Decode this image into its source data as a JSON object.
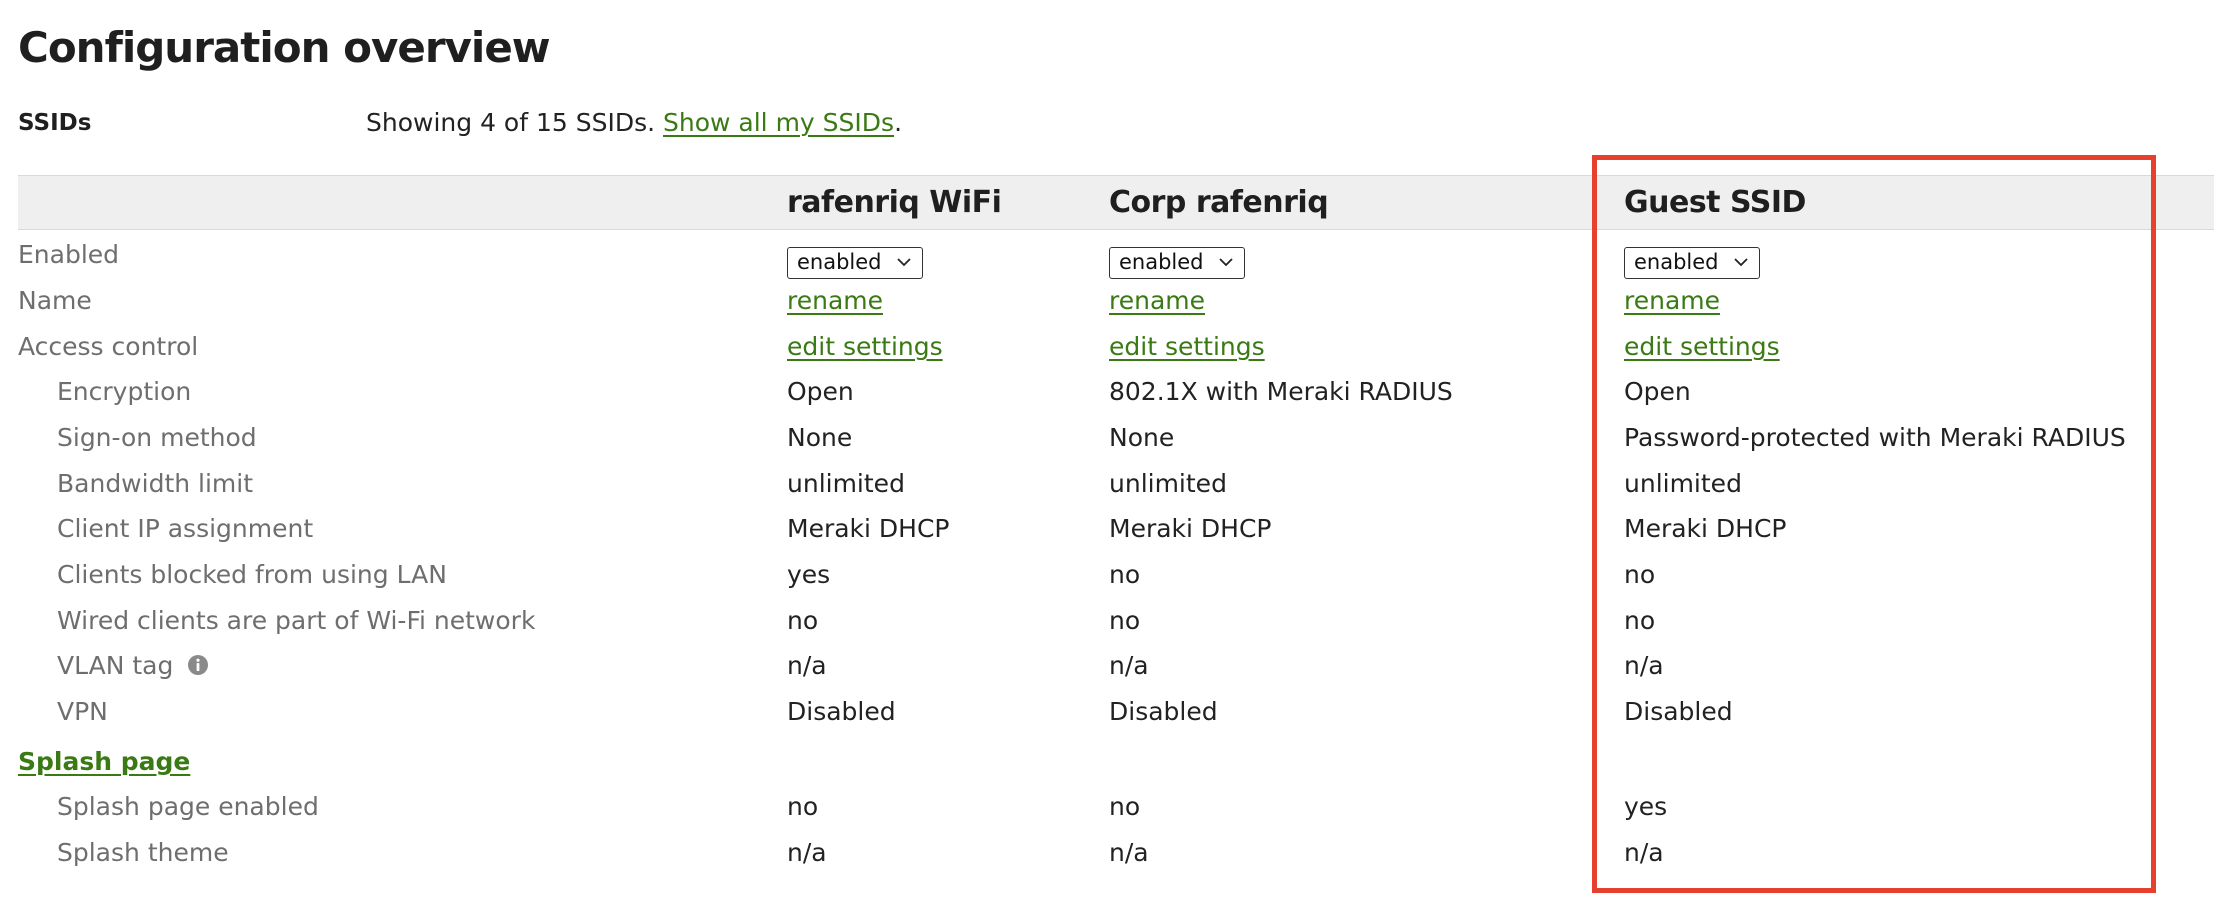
{
  "page_title": "Configuration overview",
  "ssids_section": {
    "label": "SSIDs",
    "showing_text": "Showing 4 of 15 SSIDs.",
    "show_all_link": "Show all my SSIDs",
    "period": "."
  },
  "columns": [
    "rafenriq WiFi",
    "Corp rafenriq",
    "Guest SSID"
  ],
  "rows": {
    "enabled": {
      "label": "Enabled",
      "values": [
        "enabled",
        "enabled",
        "enabled"
      ]
    },
    "name": {
      "label": "Name",
      "values": [
        "rename",
        "rename",
        "rename"
      ]
    },
    "access_control": {
      "label": "Access control",
      "values": [
        "edit settings",
        "edit settings",
        "edit settings"
      ]
    },
    "encryption": {
      "label": "Encryption",
      "values": [
        "Open",
        "802.1X with Meraki RADIUS",
        "Open"
      ]
    },
    "sign_on": {
      "label": "Sign-on method",
      "values": [
        "None",
        "None",
        "Password-protected with Meraki RADIUS"
      ]
    },
    "bandwidth": {
      "label": "Bandwidth limit",
      "values": [
        "unlimited",
        "unlimited",
        "unlimited"
      ]
    },
    "client_ip": {
      "label": "Client IP assignment",
      "values": [
        "Meraki DHCP",
        "Meraki DHCP",
        "Meraki DHCP"
      ]
    },
    "blocked_lan": {
      "label": "Clients blocked from using LAN",
      "values": [
        "yes",
        "no",
        "no"
      ]
    },
    "wired_clients": {
      "label": "Wired clients are part of Wi-Fi network",
      "values": [
        "no",
        "no",
        "no"
      ]
    },
    "vlan_tag": {
      "label": "VLAN tag",
      "values": [
        "n/a",
        "n/a",
        "n/a"
      ]
    },
    "vpn": {
      "label": "VPN",
      "values": [
        "Disabled",
        "Disabled",
        "Disabled"
      ]
    },
    "splash_enabled": {
      "label": "Splash page enabled",
      "values": [
        "no",
        "no",
        "yes"
      ]
    },
    "splash_theme": {
      "label": "Splash theme",
      "values": [
        "n/a",
        "n/a",
        "n/a"
      ]
    }
  },
  "splash_section": {
    "label": "Splash page"
  },
  "icons": {
    "vlan_info": "info-icon",
    "select_arrow": "chevron-down-icon"
  },
  "colors": {
    "link": "#3a7a14",
    "highlight": "#e8402f",
    "header_band": "#efefef",
    "label": "#6e6e6e"
  }
}
